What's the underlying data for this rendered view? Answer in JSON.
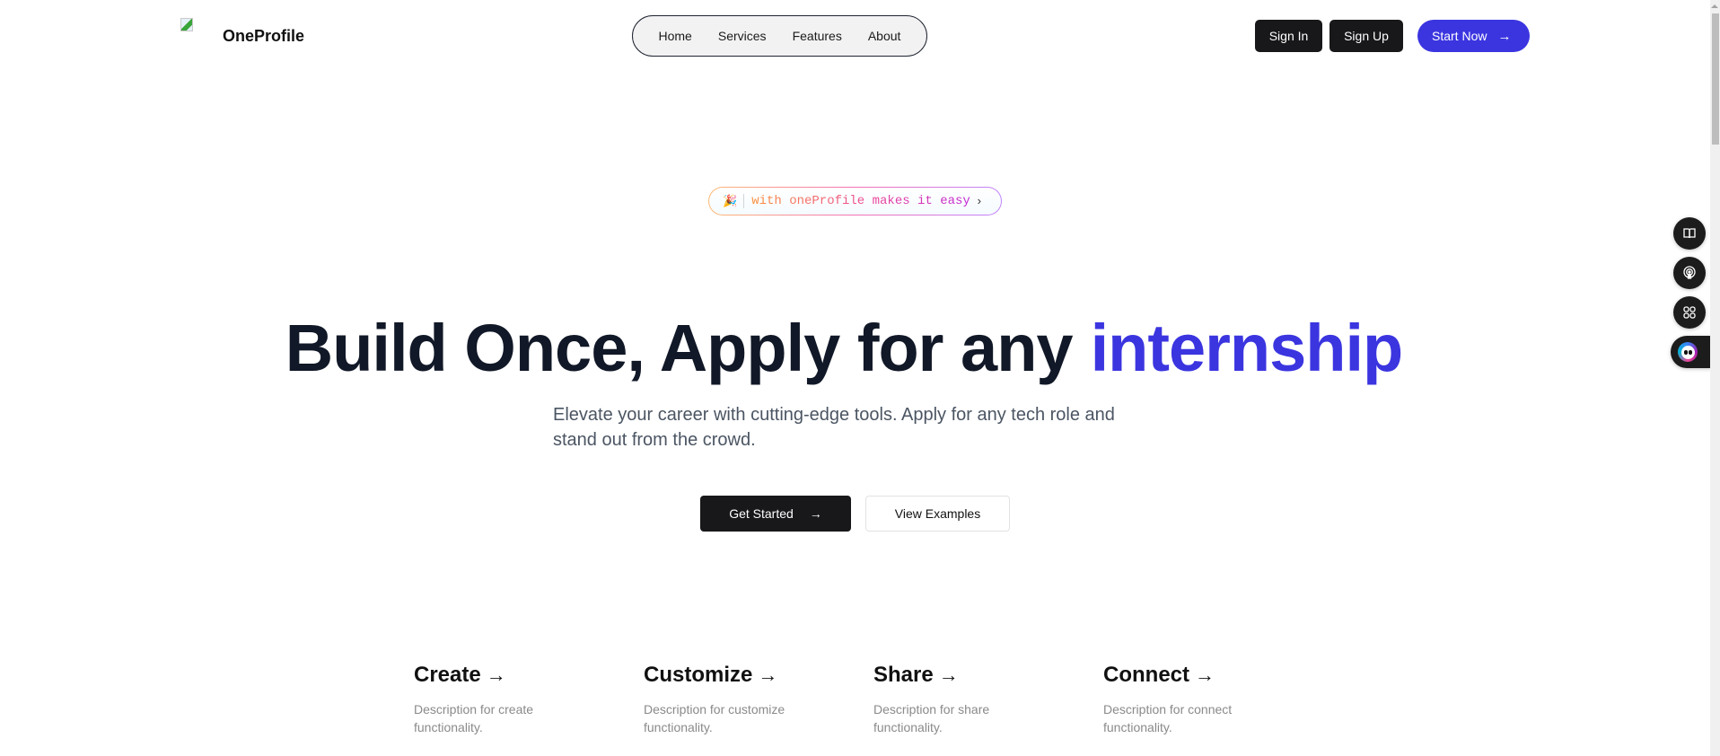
{
  "header": {
    "logo_text": "OneProfile",
    "nav": [
      "Home",
      "Services",
      "Features",
      "About"
    ],
    "sign_in": "Sign In",
    "sign_up": "Sign Up",
    "start_now": "Start Now",
    "arrow": "→"
  },
  "badge": {
    "emoji": "🎉",
    "text": "with oneProfile makes it easy",
    "chevron": "›"
  },
  "hero": {
    "title": "Build Once, Apply for any",
    "title_accent": "internship",
    "subtitle": "Elevate your career with cutting-edge tools. Apply for any tech role and stand out from the crowd.",
    "get_started": "Get Started",
    "view_examples": "View Examples",
    "arrow": "→"
  },
  "features": [
    {
      "title": "Create",
      "arrow": "→",
      "description": "Description for create functionality."
    },
    {
      "title": "Customize",
      "arrow": "→",
      "description": "Description for customize functionality."
    },
    {
      "title": "Share",
      "arrow": "→",
      "description": "Description for share functionality."
    },
    {
      "title": "Connect",
      "arrow": "→",
      "description": "Description for connect functionality."
    }
  ],
  "side_tools": [
    "book-icon",
    "podcast-icon",
    "apps-grid-icon",
    "chat-bot-icon"
  ],
  "colors": {
    "accent": "#3b35e0",
    "dark_button": "#18181b",
    "title": "#111827",
    "subtitle": "#4b5563"
  }
}
